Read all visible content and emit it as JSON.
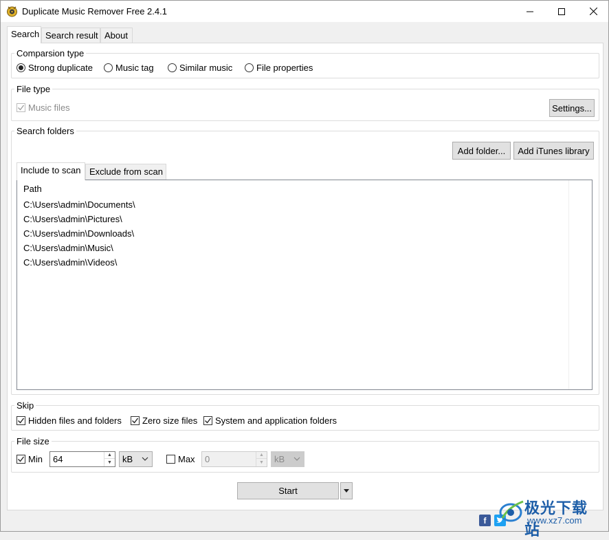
{
  "window": {
    "title": "Duplicate Music Remover Free 2.4.1"
  },
  "tabs": [
    {
      "label": "Search",
      "active": true
    },
    {
      "label": "Search result",
      "active": false
    },
    {
      "label": "About",
      "active": false
    }
  ],
  "comparison": {
    "label": "Comparsion type",
    "options": [
      {
        "label": "Strong duplicate",
        "selected": true
      },
      {
        "label": "Music tag",
        "selected": false
      },
      {
        "label": "Similar music",
        "selected": false
      },
      {
        "label": "File properties",
        "selected": false
      }
    ]
  },
  "file_type": {
    "label": "File type",
    "music_files_label": "Music files",
    "music_files_checked": true,
    "settings_button": "Settings..."
  },
  "search_folders": {
    "label": "Search folders",
    "add_folder_button": "Add folder...",
    "add_itunes_button": "Add iTunes library",
    "tabs": [
      {
        "label": "Include to scan",
        "active": true
      },
      {
        "label": "Exclude from scan",
        "active": false
      }
    ],
    "column_header": "Path",
    "paths": [
      "C:\\Users\\admin\\Documents\\",
      "C:\\Users\\admin\\Pictures\\",
      "C:\\Users\\admin\\Downloads\\",
      "C:\\Users\\admin\\Music\\",
      "C:\\Users\\admin\\Videos\\"
    ]
  },
  "skip": {
    "label": "Skip",
    "options": [
      {
        "label": "Hidden files and folders",
        "checked": true
      },
      {
        "label": "Zero size files",
        "checked": true
      },
      {
        "label": "System and application folders",
        "checked": true
      }
    ]
  },
  "file_size": {
    "label": "File size",
    "min_label": "Min",
    "min_checked": true,
    "min_value": "64",
    "min_unit": "kB",
    "max_label": "Max",
    "max_checked": false,
    "max_value": "0",
    "max_unit": "kB"
  },
  "start_button": "Start",
  "watermark": {
    "title": "极光下载站",
    "url": "www.xz7.com"
  },
  "colors": {
    "facebook": "#3b5998",
    "twitter": "#1da1f2",
    "watermark": "#1d5ea8"
  }
}
